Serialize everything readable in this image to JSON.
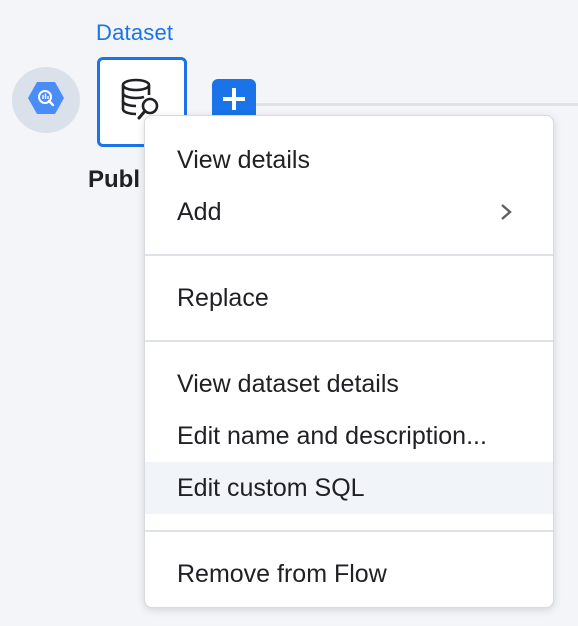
{
  "canvas": {
    "source_icon": "bigquery-hexagon-icon",
    "dataset": {
      "type_label": "Dataset",
      "icon": "database-search-icon",
      "name_visible": "Publ"
    },
    "add_button_icon": "plus-icon"
  },
  "context_menu": {
    "groups": [
      {
        "items": [
          {
            "label": "View details"
          },
          {
            "label": "Add",
            "submenu_icon": "chevron-right-icon"
          }
        ]
      },
      {
        "items": [
          {
            "label": "Replace"
          }
        ]
      },
      {
        "items": [
          {
            "label": "View dataset details"
          },
          {
            "label": "Edit name and description..."
          },
          {
            "label": "Edit custom SQL",
            "highlighted": true
          }
        ]
      },
      {
        "items": [
          {
            "label": "Remove from Flow"
          }
        ]
      }
    ]
  },
  "colors": {
    "accent": "#1a73e8",
    "canvas_bg": "#f3f5f9",
    "hover_bg": "#f1f4f9",
    "source_node_bg": "#dbe1ea"
  }
}
